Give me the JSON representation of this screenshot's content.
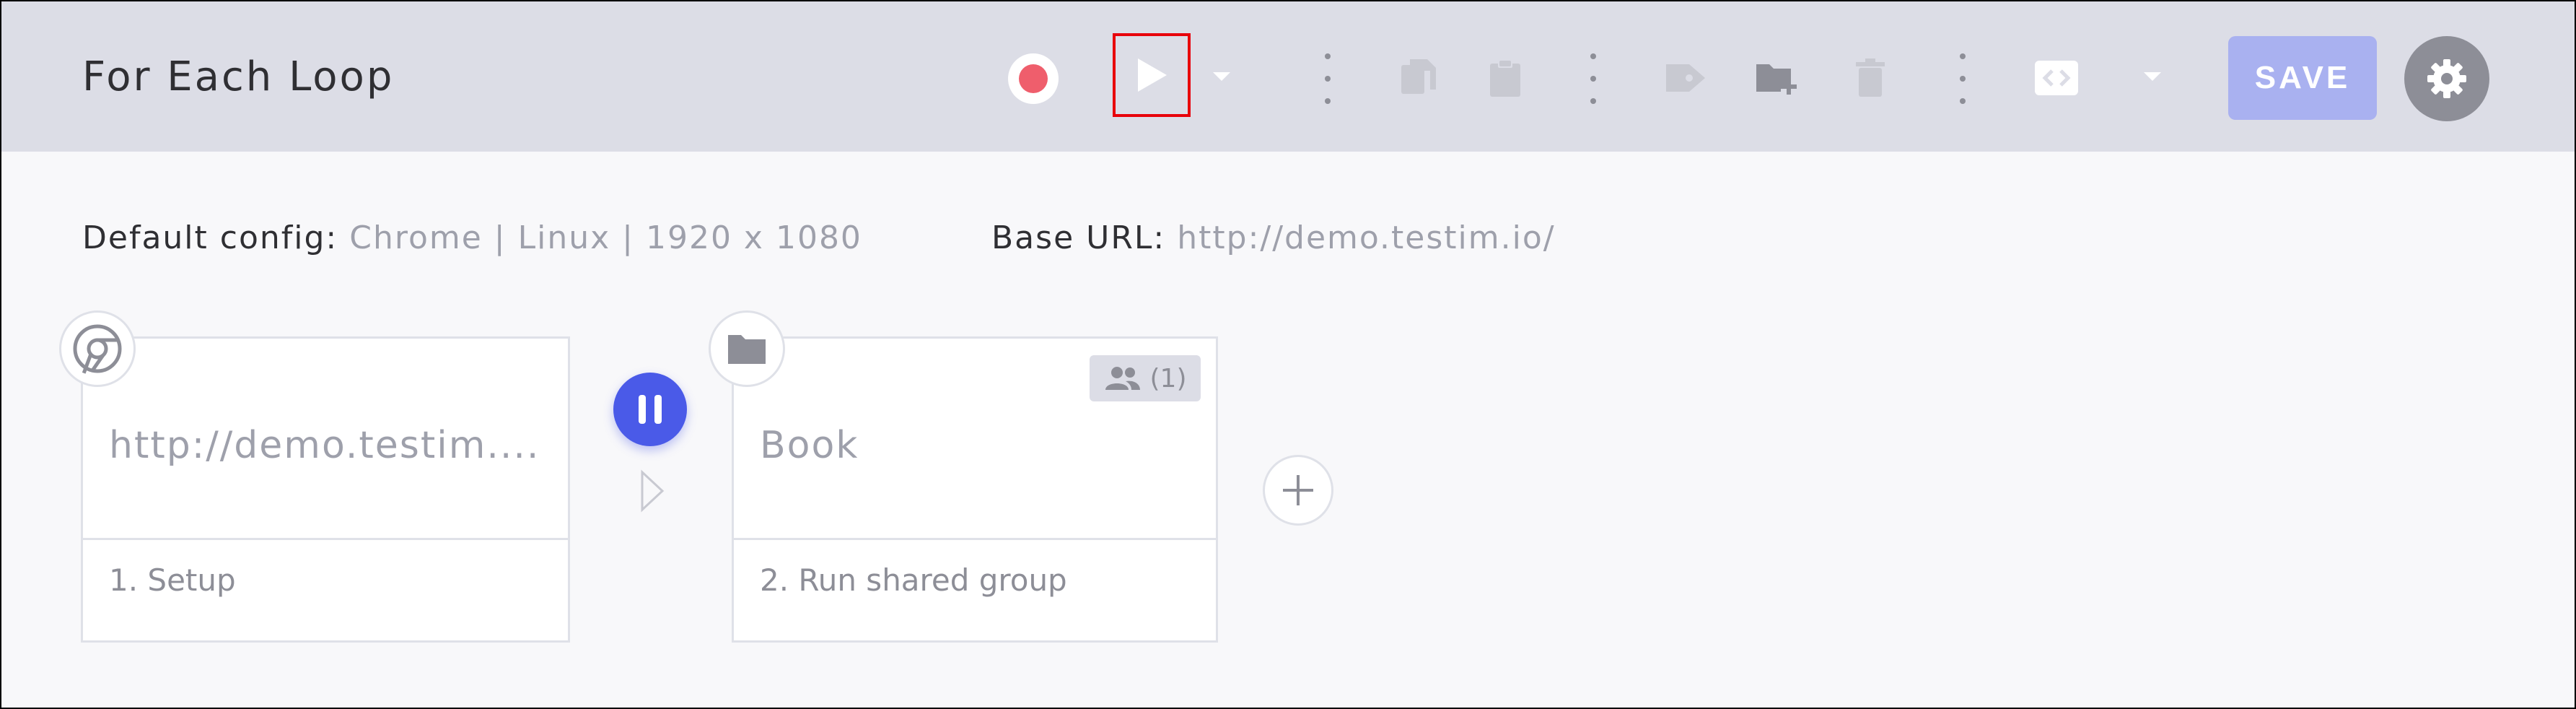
{
  "header": {
    "title": "For Each Loop",
    "save_label": "SAVE"
  },
  "icons": {
    "record": "record-icon",
    "play": "play-icon",
    "play_dropdown": "chevron-down-icon",
    "more": "kebab-icon",
    "copy": "copy-icon",
    "paste": "paste-icon",
    "tag": "tag-icon",
    "new_folder": "folder-plus-icon",
    "delete": "trash-icon",
    "code": "code-icon",
    "settings": "gear-icon"
  },
  "colors": {
    "record": "#ef5e6c",
    "play_highlight": "#e8000b",
    "save_bg": "#a9b1f0",
    "pause_bg": "#4a5ae8",
    "header_bg": "#dcdde6"
  },
  "config": {
    "default_label": "Default config:",
    "default_value": "Chrome | Linux | 1920 x 1080",
    "base_url_label": "Base URL:",
    "base_url_value": "http://demo.testim.io/"
  },
  "steps": [
    {
      "name": "http://demo.testim....",
      "label": "1. Setup",
      "icon": "chrome-icon"
    },
    {
      "name": "Book",
      "label": "2. Run shared group",
      "icon": "folder-icon",
      "badge": "(1)",
      "badge_icon": "users-icon"
    }
  ]
}
